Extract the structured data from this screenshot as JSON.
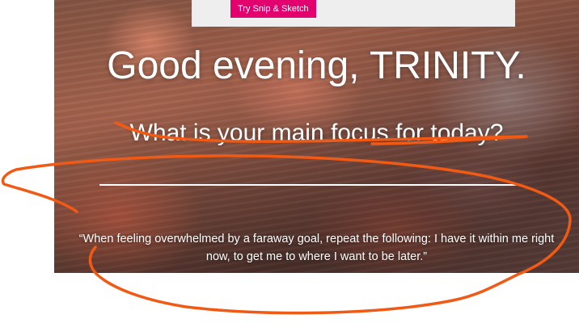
{
  "banner": {
    "button_label": "Try Snip & Sketch"
  },
  "greeting": {
    "text": "Good evening, TRINITY."
  },
  "focus": {
    "question": "What is your main focus for today?",
    "input_value": ""
  },
  "quote": {
    "text": "“When feeling overwhelmed by a faraway goal, repeat the following: I have it within me right now, to get me to where I want to be later.”"
  },
  "colors": {
    "accent": "#e3006e",
    "annotation": "#f05a14",
    "text": "#ffffff"
  }
}
